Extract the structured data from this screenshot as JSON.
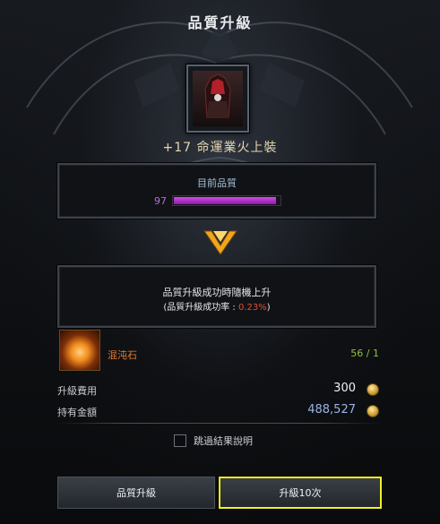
{
  "window": {
    "title": "品質升級"
  },
  "item": {
    "name": "+17 命運業火上裝",
    "icon": "red-armor-chest-icon"
  },
  "quality": {
    "label": "目前品質",
    "value": "97",
    "progress": 0.97,
    "bar_color": "#c43bdc"
  },
  "description": {
    "line1": "品質升級成功時隨機上升",
    "line2_prefix": "(品質升級成功率 : ",
    "rate": "0.23%",
    "line2_suffix": ")"
  },
  "material": {
    "name": "混沌石",
    "count": "56 / 1",
    "icon": "chaos-stone-icon"
  },
  "cost": {
    "label": "升級費用",
    "value": "300",
    "icon": "gold-coin-icon"
  },
  "gold": {
    "label": "持有金額",
    "value": "488,527",
    "icon": "gold-coin-icon"
  },
  "options": {
    "skip_result_label": "跳過結果說明",
    "skip_checked": false
  },
  "buttons": {
    "upgrade_once": "品質升級",
    "upgrade_ten": "升級10次"
  },
  "colors": {
    "highlight_border": "#f2f226",
    "rate": "#e0502f",
    "material": "#e77b35",
    "count": "#8fc23f"
  }
}
